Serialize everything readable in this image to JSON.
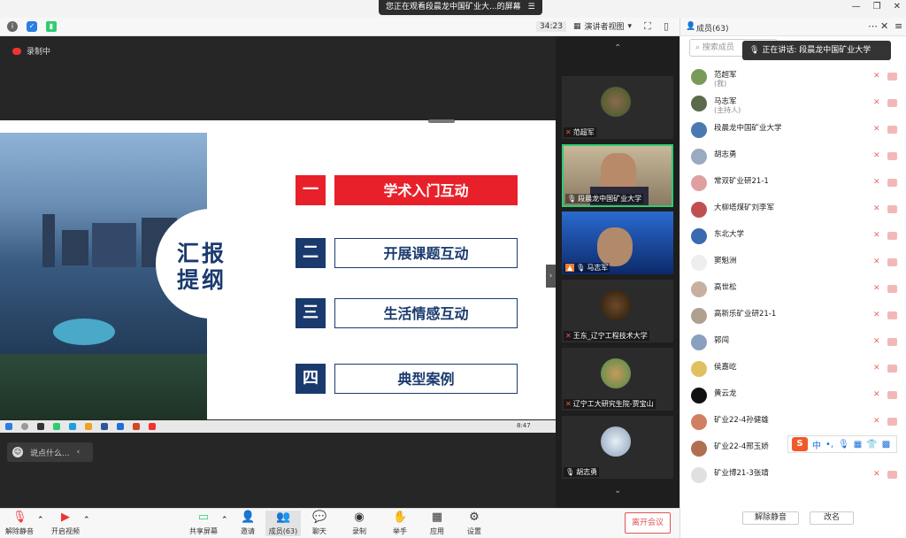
{
  "banner": {
    "text": "您正在观看段晨龙中国矿业大...的屏幕",
    "icon": "list-icon"
  },
  "toolbar": {
    "timer": "34:23",
    "view": "演讲者视图"
  },
  "recording": "录制中",
  "slide": {
    "title_line1": "汇报",
    "title_line2": "提纲",
    "items": [
      {
        "num": "一",
        "label": "学术入门互动",
        "accent": "#e8202a"
      },
      {
        "num": "二",
        "label": "开展课题互动",
        "accent": "#1a3a6e"
      },
      {
        "num": "三",
        "label": "生活情感互动",
        "accent": "#1a3a6e"
      },
      {
        "num": "四",
        "label": "典型案例",
        "accent": "#1a3a6e"
      }
    ],
    "tray_time": "8:47"
  },
  "chat_placeholder": "说点什么...",
  "thumbs": [
    {
      "name": "范超军"
    },
    {
      "name": "段晨龙中国矿业大学"
    },
    {
      "name": "马志军"
    },
    {
      "name": "王东_辽宁工程技术大学"
    },
    {
      "name": "辽宁工大研究生院-贾宝山"
    },
    {
      "name": "胡志勇"
    }
  ],
  "panel": {
    "title": "成员(63)",
    "search_placeholder": "搜索成员",
    "speaking": "正在讲话: 段晨龙中国矿业大学",
    "members": [
      {
        "name": "范超军",
        "role": "(我)"
      },
      {
        "name": "马志军",
        "role": "(主持人)"
      },
      {
        "name": "段晨龙中国矿业大学",
        "role": ""
      },
      {
        "name": "胡志勇",
        "role": ""
      },
      {
        "name": "常双矿业研21-1",
        "role": ""
      },
      {
        "name": "大柳塔煤矿刘李军",
        "role": ""
      },
      {
        "name": "东北大学",
        "role": ""
      },
      {
        "name": "窦魁洲",
        "role": ""
      },
      {
        "name": "高世松",
        "role": ""
      },
      {
        "name": "高新乐矿业研21-1",
        "role": ""
      },
      {
        "name": "郭闯",
        "role": ""
      },
      {
        "name": "侯嘉屹",
        "role": ""
      },
      {
        "name": "黄云龙",
        "role": ""
      },
      {
        "name": "矿业22-4孙健雄",
        "role": ""
      },
      {
        "name": "矿业22-4邢玉娇",
        "role": ""
      },
      {
        "name": "矿业博21-3张靖",
        "role": ""
      }
    ],
    "mute_all": "解除静音",
    "rename": "改名"
  },
  "ime": {
    "logo": "S",
    "lang": "中"
  },
  "bottom": {
    "unmute": "解除静音",
    "video": "开启视频",
    "share": "共享屏幕",
    "invite": "邀请",
    "members": "成员(63)",
    "chat": "聊天",
    "record": "录制",
    "hand": "举手",
    "apps": "应用",
    "settings": "设置",
    "leave": "离开会议"
  }
}
